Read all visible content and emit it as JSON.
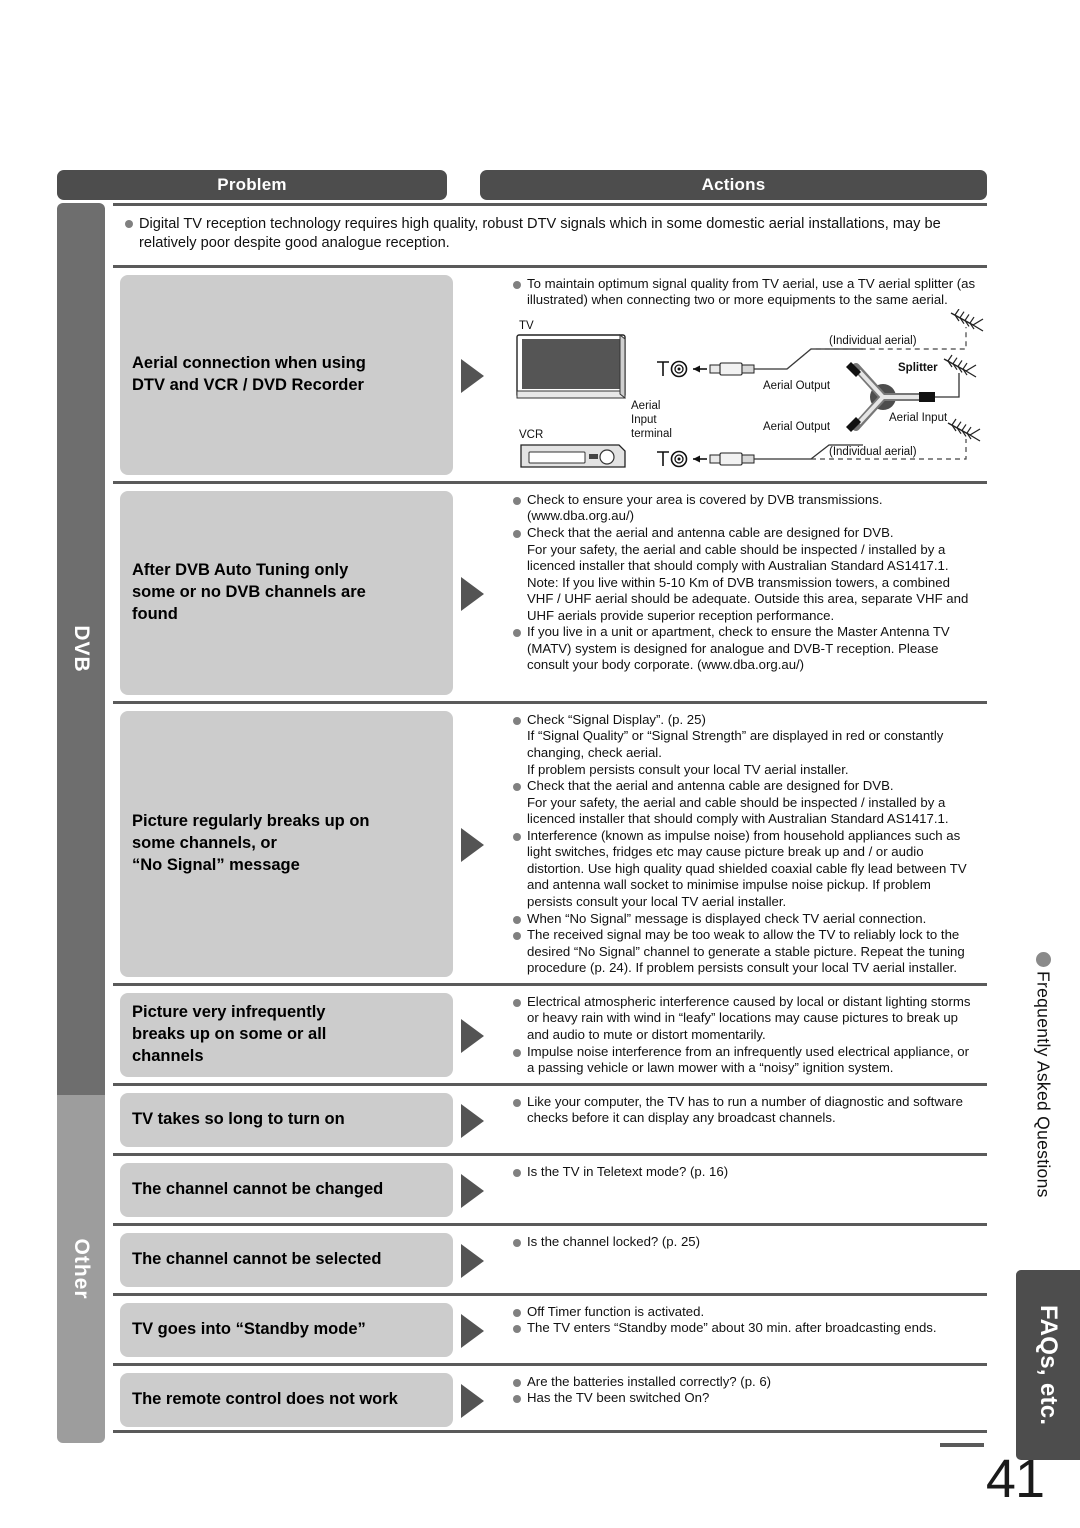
{
  "headers": {
    "problem": "Problem",
    "actions": "Actions"
  },
  "rail": {
    "dvb": "DVB",
    "other": "Other"
  },
  "intro": {
    "text": "Digital TV reception technology requires high quality, robust DTV signals which in some domestic aerial installations, may be relatively poor despite good analogue reception."
  },
  "rows": [
    {
      "problem": "Aerial connection when using\nDTV and VCR / DVD Recorder",
      "actions": [
        "To maintain optimum signal quality from TV aerial, use a TV aerial splitter (as illustrated) when connecting two or more equipments to the same aerial."
      ],
      "diagram": {
        "tv_label": "TV",
        "vcr_label": "VCR",
        "aerial_input_terminal": "Aerial\nInput\nterminal",
        "aerial_output_top": "Aerial Output",
        "aerial_output_bottom": "Aerial Output",
        "splitter": "Splitter",
        "aerial_input": "Aerial Input",
        "individual_aerial_top": "(Individual aerial)",
        "individual_aerial_bottom": "(Individual aerial)"
      }
    },
    {
      "problem": "After DVB Auto Tuning only\nsome or no DVB channels are\nfound",
      "actions": [
        "Check to ensure your area is covered by DVB transmissions.\n(www.dba.org.au/)",
        "Check that the aerial and antenna cable are designed for DVB.\nFor your safety, the aerial and cable should be inspected / installed by a licenced installer that should comply with Australian Standard AS1417.1.\nNote: If you live within 5-10 Km of DVB transmission towers, a combined VHF / UHF aerial should be adequate. Outside this area, separate VHF and UHF aerials provide superior reception performance.",
        "If you live in a unit or apartment, check to ensure the Master Antenna TV (MATV) system is designed for analogue and DVB-T reception. Please consult your body corporate. (www.dba.org.au/)"
      ]
    },
    {
      "problem": "Picture regularly breaks up on\nsome channels, or\n“No Signal” message",
      "actions": [
        "Check “Signal Display”. (p. 25)\nIf “Signal Quality” or “Signal Strength” are displayed in red or constantly changing, check aerial.\nIf problem persists consult your local TV aerial installer.",
        "Check that the aerial and antenna cable are designed for DVB.\nFor your safety, the aerial and cable should be inspected / installed by a licenced installer that should comply with Australian Standard AS1417.1.",
        "Interference (known as impulse noise) from household appliances such as light switches, fridges etc may cause picture break up and / or audio distortion. Use high quality quad shielded coaxial cable fly lead between TV and antenna wall socket to minimise impulse noise pickup. If problem persists consult your local TV aerial installer.",
        "When “No Signal” message is displayed check TV aerial connection.",
        "The received signal may be too weak to allow the TV to reliably lock to the desired “No Signal” channel to generate a stable picture. Repeat the tuning procedure (p. 24). If problem persists consult your local TV aerial installer."
      ]
    },
    {
      "problem": "Picture very infrequently\nbreaks up on some or all\nchannels",
      "actions": [
        "Electrical atmospheric interference caused by local or distant lighting storms or heavy rain with wind in “leafy” locations may cause pictures to break up and audio to mute or distort momentarily.",
        "Impulse noise interference from an infrequently used electrical appliance, or a passing vehicle or lawn mower with a “noisy” ignition system."
      ]
    },
    {
      "problem": "TV takes so long to turn on",
      "actions": [
        "Like your computer, the TV has to run a number of diagnostic and software checks before it can display any broadcast channels."
      ]
    },
    {
      "problem": "The channel cannot be changed",
      "actions": [
        "Is the TV in Teletext mode? (p. 16)"
      ]
    },
    {
      "problem": "The channel cannot be selected",
      "actions": [
        "Is the channel locked? (p. 25)"
      ]
    },
    {
      "problem": "TV goes into “Standby mode”",
      "actions": [
        "Off Timer function is activated.",
        "The TV enters “Standby mode” about 30 min. after broadcasting ends."
      ]
    },
    {
      "problem": "The remote control does not work",
      "actions": [
        "Are the batteries installed correctly? (p. 6)",
        "Has the TV been switched On?"
      ]
    }
  ],
  "side": {
    "faq_text": "Frequently Asked Questions",
    "tab_label": "FAQs, etc."
  },
  "page_number": "41",
  "colors": {
    "header_bg": "#4d4d4d",
    "problem_box_bg": "#cccccc",
    "rail_dvb_bg": "#6e6e6e",
    "rail_other_bg": "#9d9d9d",
    "arrow": "#545454",
    "bullet": "#808080"
  }
}
